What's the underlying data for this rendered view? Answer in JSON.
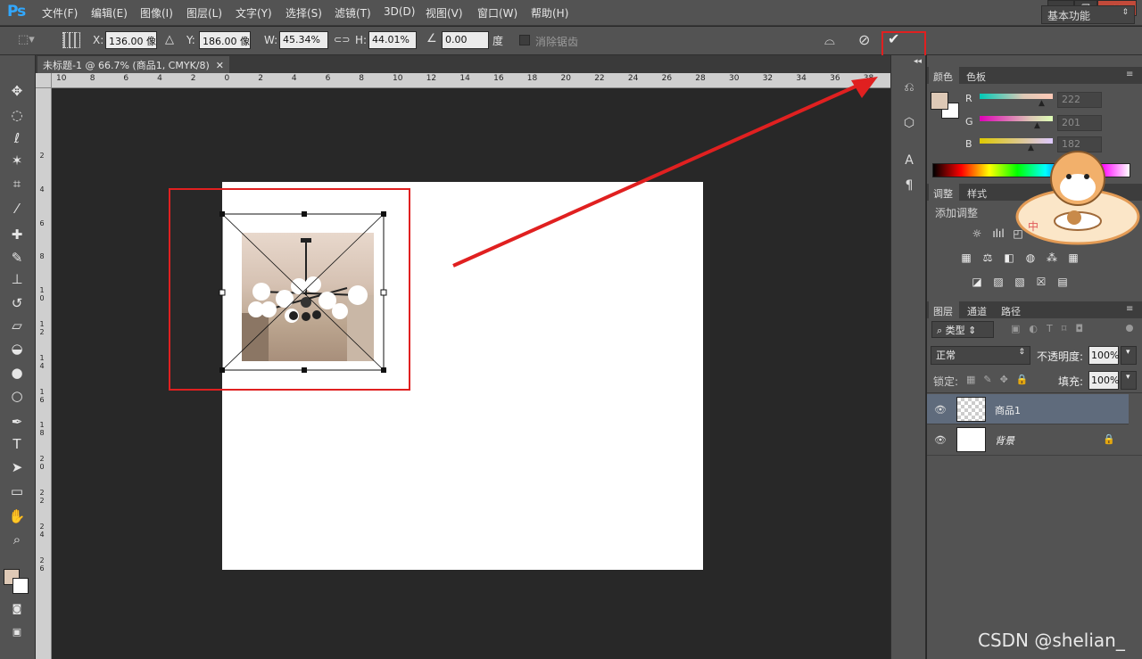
{
  "app": {
    "logo": "Ps"
  },
  "menu": [
    {
      "label": "文件(F)"
    },
    {
      "label": "编辑(E)"
    },
    {
      "label": "图像(I)"
    },
    {
      "label": "图层(L)"
    },
    {
      "label": "文字(Y)"
    },
    {
      "label": "选择(S)"
    },
    {
      "label": "滤镜(T)"
    },
    {
      "label": "3D(D)"
    },
    {
      "label": "视图(V)"
    },
    {
      "label": "窗口(W)"
    },
    {
      "label": "帮助(H)"
    }
  ],
  "window_controls": {
    "minimize": "—",
    "restore": "❐",
    "close": "✕"
  },
  "options": {
    "x_label": "X:",
    "x_value": "136.00 像",
    "y_label": "Y:",
    "y_value": "186.00 像",
    "w_label": "W:",
    "w_value": "45.34%",
    "h_label": "H:",
    "h_value": "44.01%",
    "angle_value": "0.00",
    "angle_unit": "度",
    "antialias_label": "消除锯齿",
    "workspace": "基本功能"
  },
  "document_tab": {
    "title": "未标题-1 @ 66.7% (商品1, CMYK/8)",
    "close": "✕"
  },
  "ruler_top_labels": [
    "10",
    "8",
    "6",
    "4",
    "2",
    "0",
    "2",
    "4",
    "6",
    "8",
    "10",
    "12",
    "14",
    "16",
    "18",
    "20",
    "22",
    "24",
    "26",
    "28",
    "30",
    "32",
    "34",
    "36",
    "38"
  ],
  "ruler_left_labels": [
    "2",
    "4",
    "6",
    "8",
    "1\n0",
    "1\n2",
    "1\n4",
    "1\n6",
    "1\n8",
    "2\n0",
    "2\n2",
    "2\n4",
    "2\n6"
  ],
  "color_panel": {
    "tabs": [
      "颜色",
      "色板"
    ],
    "r_label": "R",
    "r_value": "222",
    "g_label": "G",
    "g_value": "201",
    "b_label": "B",
    "b_value": "182",
    "foreground": "#dec9b6",
    "background": "#ffffff"
  },
  "adjust_panel": {
    "tabs": [
      "调整",
      "样式"
    ],
    "add_label": "添加调整"
  },
  "layers_panel": {
    "tabs": [
      "图层",
      "通道",
      "路径"
    ],
    "filter_kind": "类型",
    "blend_mode": "正常",
    "opacity_label": "不透明度:",
    "opacity_value": "100%",
    "lock_label": "锁定:",
    "fill_label": "填充:",
    "fill_value": "100%",
    "layers": [
      {
        "name": "商品1",
        "selected": true
      },
      {
        "name": "背景",
        "locked": true
      }
    ]
  },
  "watermark": "CSDN @shelian_",
  "sticker_text": "中"
}
